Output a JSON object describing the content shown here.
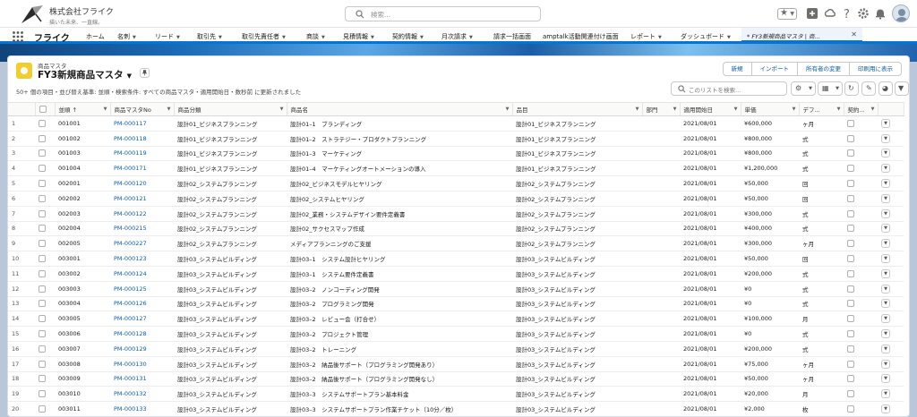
{
  "header": {
    "company_name": "株式会社フライク",
    "company_tagline": "描いた未来、一直線。",
    "search_placeholder": "検索..."
  },
  "nav": {
    "app_name": "フライク",
    "items": [
      "ホーム",
      "名刺",
      "リード",
      "取引先",
      "取引先責任者",
      "商談",
      "見積情報",
      "契約情報",
      "月次請求",
      "請求一括画面",
      "amptalk活動関連付け画面",
      "レポート",
      "ダッシュボード"
    ],
    "active_tab": "* FY3新規商品マスタ | 商..."
  },
  "list": {
    "object_label": "商品マスタ",
    "title": "FY3新規商品マスタ",
    "buttons": [
      "新規",
      "インポート",
      "所有者の変更",
      "印刷用に表示"
    ],
    "status": "50+ 個の項目・並び替え基準: 並順・検索条件: すべての商品マスタ・適用開始日・数秒前 に更新されました",
    "search_placeholder": "このリストを検索...",
    "columns": [
      "",
      "",
      "並順 ↑",
      "商品マスタNo",
      "商品分類",
      "商品名",
      "品目",
      "部門",
      "適用開始日",
      "単価",
      "デフ...",
      "契約...",
      ""
    ],
    "rows": [
      {
        "n": "1",
        "seq": "001001",
        "no": "PM-000117",
        "cat": "設計01_ビジネスプランニング",
        "name": "設計01–1　ブランディング",
        "item": "設計01_ビジネスプランニング",
        "date": "2021/08/01",
        "price": "¥600,000",
        "unit": "ヶ月"
      },
      {
        "n": "2",
        "seq": "001002",
        "no": "PM-000118",
        "cat": "設計01_ビジネスプランニング",
        "name": "設計01–2　ストラテジー・プロダクトプランニング",
        "item": "設計01_ビジネスプランニング",
        "date": "2021/08/01",
        "price": "¥800,000",
        "unit": "式"
      },
      {
        "n": "3",
        "seq": "001003",
        "no": "PM-000119",
        "cat": "設計01_ビジネスプランニング",
        "name": "設計01–3　マーケティング",
        "item": "設計01_ビジネスプランニング",
        "date": "2021/08/01",
        "price": "¥800,000",
        "unit": "式"
      },
      {
        "n": "4",
        "seq": "001004",
        "no": "PM-000171",
        "cat": "設計01_ビジネスプランニング",
        "name": "設計01–4　マーケティングオートメーションの導入",
        "item": "設計01_ビジネスプランニング",
        "date": "2021/08/01",
        "price": "¥1,200,000",
        "unit": "式"
      },
      {
        "n": "5",
        "seq": "002001",
        "no": "PM-000120",
        "cat": "設計02_システムプランニング",
        "name": "設計02_ビジネスモデルヒヤリング",
        "item": "設計02_システムプランニング",
        "date": "2021/08/01",
        "price": "¥50,000",
        "unit": "回"
      },
      {
        "n": "6",
        "seq": "002002",
        "no": "PM-000121",
        "cat": "設計02_システムプランニング",
        "name": "設計02_システムヒヤリング",
        "item": "設計02_システムプランニング",
        "date": "2021/08/01",
        "price": "¥50,000",
        "unit": "回"
      },
      {
        "n": "7",
        "seq": "002003",
        "no": "PM-000122",
        "cat": "設計02_システムプランニング",
        "name": "設計02_業務・システムデザイン要件定義書",
        "item": "設計02_システムプランニング",
        "date": "2021/08/01",
        "price": "¥300,000",
        "unit": "式"
      },
      {
        "n": "8",
        "seq": "002004",
        "no": "PM-000215",
        "cat": "設計02_システムプランニング",
        "name": "設計02_サクセスマップ作成",
        "item": "設計02_システムプランニング",
        "date": "2021/08/01",
        "price": "¥400,000",
        "unit": "式"
      },
      {
        "n": "9",
        "seq": "002005",
        "no": "PM-000227",
        "cat": "設計02_システムプランニング",
        "name": "メディアプランニングのご支援",
        "item": "設計02_システムプランニング",
        "date": "2021/08/01",
        "price": "¥300,000",
        "unit": "ヶ月"
      },
      {
        "n": "10",
        "seq": "003001",
        "no": "PM-000123",
        "cat": "設計03_システムビルディング",
        "name": "設計03–1　システム設計ヒヤリング",
        "item": "設計03_システムビルディング",
        "date": "2021/08/01",
        "price": "¥50,000",
        "unit": "回"
      },
      {
        "n": "11",
        "seq": "003002",
        "no": "PM-000124",
        "cat": "設計03_システムビルディング",
        "name": "設計03–1　システム要件定義書",
        "item": "設計03_システムビルディング",
        "date": "2021/08/01",
        "price": "¥200,000",
        "unit": "式"
      },
      {
        "n": "12",
        "seq": "003003",
        "no": "PM-000125",
        "cat": "設計03_システムビルディング",
        "name": "設計03–2　ノンコーディング開発",
        "item": "設計03_システムビルディング",
        "date": "2021/08/01",
        "price": "¥0",
        "unit": "式"
      },
      {
        "n": "13",
        "seq": "003004",
        "no": "PM-000126",
        "cat": "設計03_システムビルディング",
        "name": "設計03–2　プログラミング開発",
        "item": "設計03_システムビルディング",
        "date": "2021/08/01",
        "price": "¥0",
        "unit": "式"
      },
      {
        "n": "14",
        "seq": "003005",
        "no": "PM-000127",
        "cat": "設計03_システムビルディング",
        "name": "設計03–2　レビュー会（打合せ）",
        "item": "設計03_システムビルディング",
        "date": "2021/08/01",
        "price": "¥100,000",
        "unit": "月"
      },
      {
        "n": "15",
        "seq": "003006",
        "no": "PM-000128",
        "cat": "設計03_システムビルディング",
        "name": "設計03–2　プロジェクト管理",
        "item": "設計03_システムビルディング",
        "date": "2021/08/01",
        "price": "¥0",
        "unit": "式"
      },
      {
        "n": "16",
        "seq": "003007",
        "no": "PM-000129",
        "cat": "設計03_システムビルディング",
        "name": "設計03–2　トレーニング",
        "item": "設計03_システムビルディング",
        "date": "2021/08/01",
        "price": "¥200,000",
        "unit": "式"
      },
      {
        "n": "17",
        "seq": "003008",
        "no": "PM-000130",
        "cat": "設計03_システムビルディング",
        "name": "設計03–2　納品後サポート（プログラミング開発あり）",
        "item": "設計03_システムビルディング",
        "date": "2021/08/01",
        "price": "¥75,000",
        "unit": "ヶ月"
      },
      {
        "n": "18",
        "seq": "003009",
        "no": "PM-000131",
        "cat": "設計03_システムビルディング",
        "name": "設計03–2　納品後サポート（プログラミング開発なし）",
        "item": "設計03_システムビルディング",
        "date": "2021/08/01",
        "price": "¥50,000",
        "unit": "ヶ月"
      },
      {
        "n": "19",
        "seq": "003010",
        "no": "PM-000132",
        "cat": "設計03_システムビルディング",
        "name": "設計03–3　システムサポートプラン基本料金",
        "item": "設計03_システムビルディング",
        "date": "2021/08/01",
        "price": "¥20,000",
        "unit": "月"
      },
      {
        "n": "20",
        "seq": "003011",
        "no": "PM-000133",
        "cat": "設計03_システムビルディング",
        "name": "設計03–3　システムサポートプラン作業チケット（10分／枚）",
        "item": "設計03_システムビルディング",
        "date": "2021/08/01",
        "price": "¥2,000",
        "unit": "枚"
      }
    ]
  },
  "icons": {
    "search": "search-icon",
    "favorite": "star-icon",
    "add": "plus-icon",
    "setup_assist": "cloud-icon",
    "help": "question-icon",
    "settings": "gear-icon",
    "notifications": "bell-icon",
    "app_launcher": "grid-icon"
  }
}
